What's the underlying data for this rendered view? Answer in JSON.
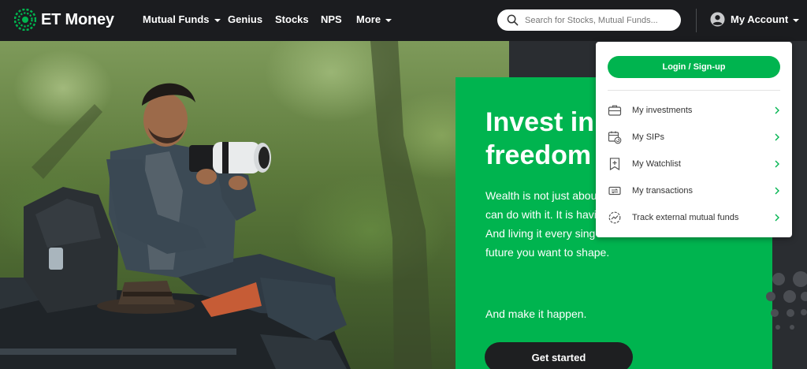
{
  "brand": {
    "name": "ET Money",
    "accent": "#00b44f"
  },
  "nav": {
    "items": [
      {
        "label": "Mutual Funds",
        "has_caret": true
      },
      {
        "label": "Genius",
        "has_caret": false
      },
      {
        "label": "Stocks",
        "has_caret": false
      },
      {
        "label": "NPS",
        "has_caret": false
      },
      {
        "label": "More",
        "has_caret": true
      }
    ],
    "search": {
      "placeholder": "Search for Stocks, Mutual Funds...",
      "value": "",
      "icon": "search-icon"
    },
    "account": {
      "label": "My Account",
      "icon": "user-circle-icon"
    }
  },
  "hero": {
    "headline_line1": "Invest in",
    "headline_line2": "freedom",
    "body_lines": [
      "Wealth is not just about",
      "can do with it. It is havi",
      "And living it every sing",
      "future you want to shape."
    ],
    "tagline": "And make it happen.",
    "cta_label": "Get started"
  },
  "account_menu": {
    "login_label": "Login / Sign-up",
    "items": [
      {
        "label": "My investments",
        "icon": "briefcase-icon"
      },
      {
        "label": "My SIPs",
        "icon": "calendar-refresh-icon"
      },
      {
        "label": "My Watchlist",
        "icon": "bookmark-plus-icon"
      },
      {
        "label": "My transactions",
        "icon": "transfer-icon"
      },
      {
        "label": "Track external mutual funds",
        "icon": "trend-circle-icon"
      }
    ]
  }
}
